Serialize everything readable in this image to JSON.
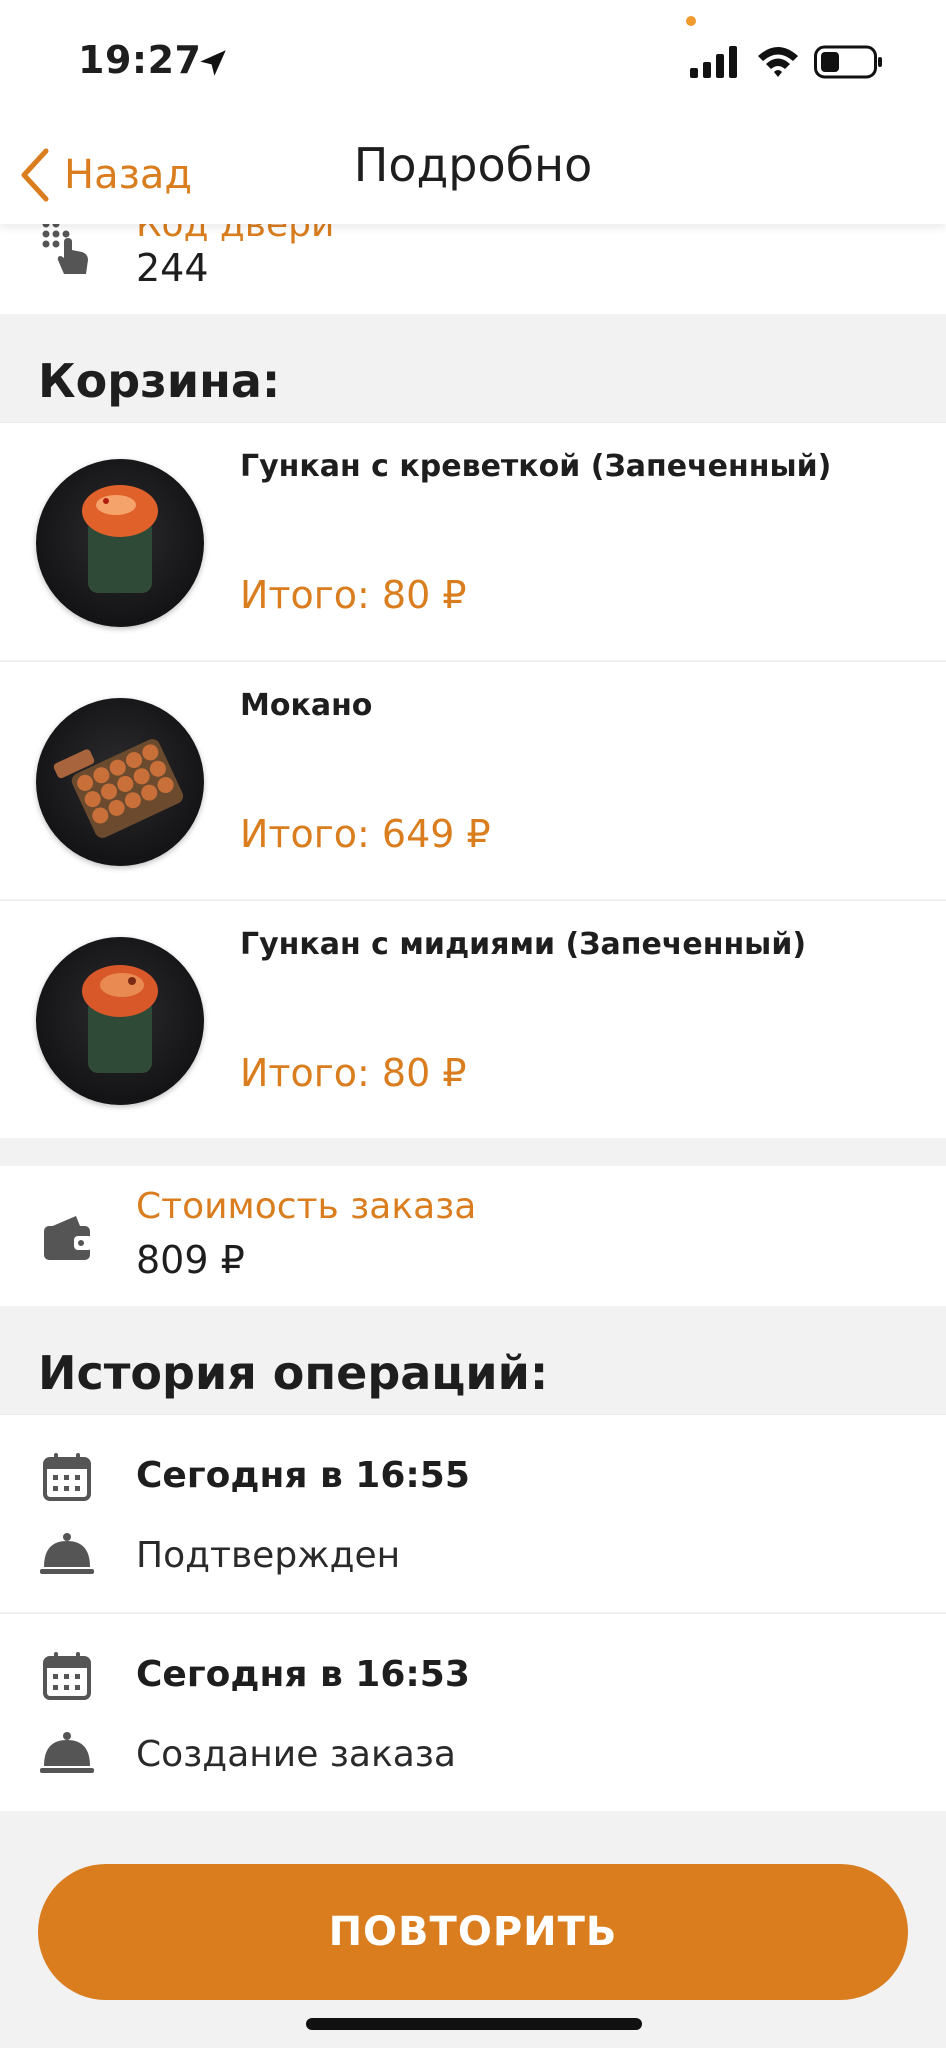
{
  "status_bar": {
    "time": "19:27"
  },
  "nav": {
    "back_label": "Назад",
    "title": "Подробно"
  },
  "door": {
    "label": "Код двери",
    "value": "244"
  },
  "cart": {
    "title": "Корзина:",
    "items": [
      {
        "name": "Гункан с креветкой (Запеченный)",
        "total": "Итого: 80 ₽"
      },
      {
        "name": "Мокано",
        "total": "Итого: 649 ₽"
      },
      {
        "name": "Гункан с мидиями (Запеченный)",
        "total": "Итого: 80 ₽"
      }
    ]
  },
  "order_cost": {
    "label": "Стоимость заказа",
    "value": "809 ₽"
  },
  "history": {
    "title": "История операций:",
    "entries": [
      {
        "date": "Сегодня в 16:55",
        "status": "Подтвержден"
      },
      {
        "date": "Сегодня в 16:53",
        "status": "Создание заказа"
      }
    ]
  },
  "repeat_button": {
    "label": "ПОВТОРИТЬ"
  },
  "colors": {
    "accent": "#d97d1e",
    "text": "#1e1e1e",
    "background": "#f2f2f2"
  }
}
